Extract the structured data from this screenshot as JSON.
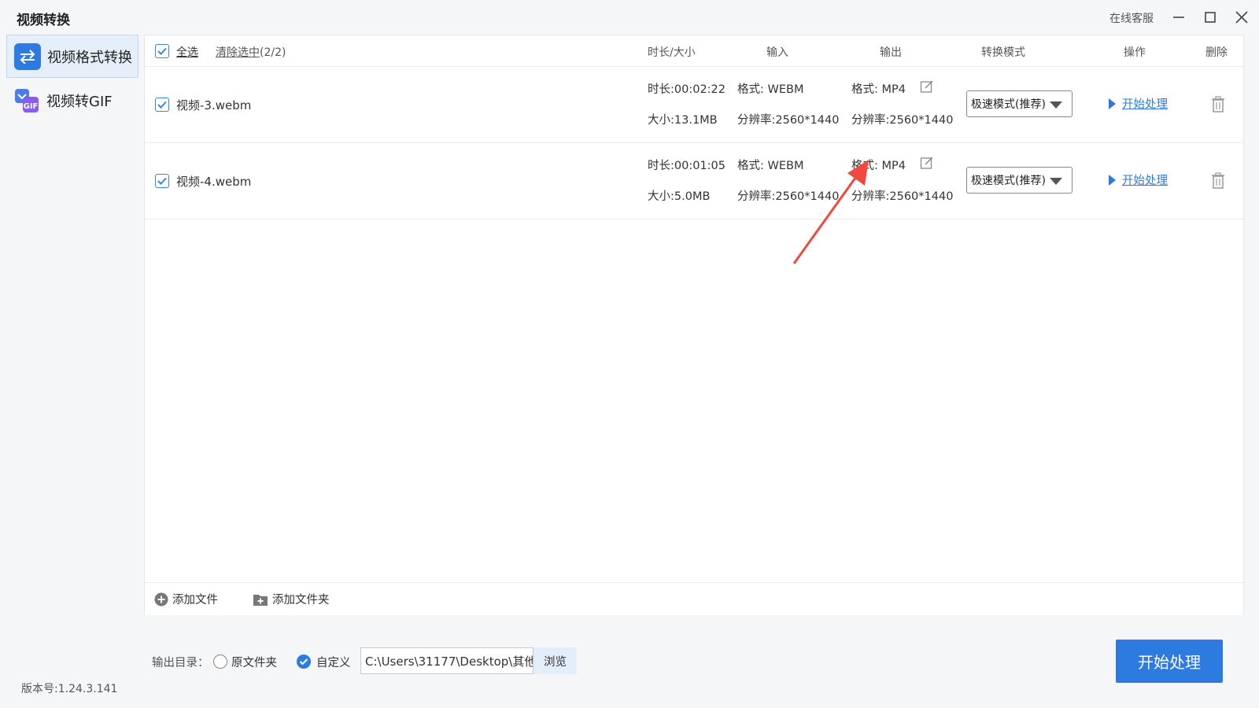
{
  "window": {
    "title": "视频转换",
    "service_label": "在线客服",
    "icons": [
      "minimize-icon",
      "maximize-icon",
      "close-icon"
    ]
  },
  "sidebar": {
    "items": [
      {
        "label": "视频格式转换",
        "icon": "swap-arrows-icon",
        "active": true
      },
      {
        "label": "视频转GIF",
        "icon": "gif-icon",
        "active": false
      }
    ],
    "version": "版本号:1.24.3.141"
  },
  "table": {
    "select_all": "全选",
    "clear_selection": "清除选中",
    "selection_count": "(2/2)",
    "columns": {
      "duration_size": "时长/大小",
      "input": "输入",
      "output": "输出",
      "mode": "转换模式",
      "action": "操作",
      "delete": "删除"
    },
    "rows": [
      {
        "checked": true,
        "name": "视频-3.webm",
        "duration": "时长:00:02:22",
        "size": "大小:13.1MB",
        "in_format": "格式: WEBM",
        "in_resolution": "分辨率:2560*1440",
        "out_format": "格式: MP4",
        "out_resolution": "分辨率:2560*1440",
        "mode": "极速模式(推荐)",
        "action": "开始处理"
      },
      {
        "checked": true,
        "name": "视频-4.webm",
        "duration": "时长:00:01:05",
        "size": "大小:5.0MB",
        "in_format": "格式: WEBM",
        "in_resolution": "分辨率:2560*1440",
        "out_format": "格式: MP4",
        "out_resolution": "分辨率:2560*1440",
        "mode": "极速模式(推荐)",
        "action": "开始处理"
      }
    ]
  },
  "footer": {
    "add_file": "添加文件",
    "add_folder": "添加文件夹"
  },
  "output": {
    "label": "输出目录：",
    "option_original": "原文件夹",
    "option_custom": "自定义",
    "selected": "自定义",
    "path": "C:\\Users\\31177\\Desktop\\其他",
    "browse": "浏览",
    "start_button": "开始处理"
  },
  "colors": {
    "accent": "#2d7be0",
    "annotation_arrow": "#f04a3e",
    "gif_icon": "#8a5cf0"
  }
}
